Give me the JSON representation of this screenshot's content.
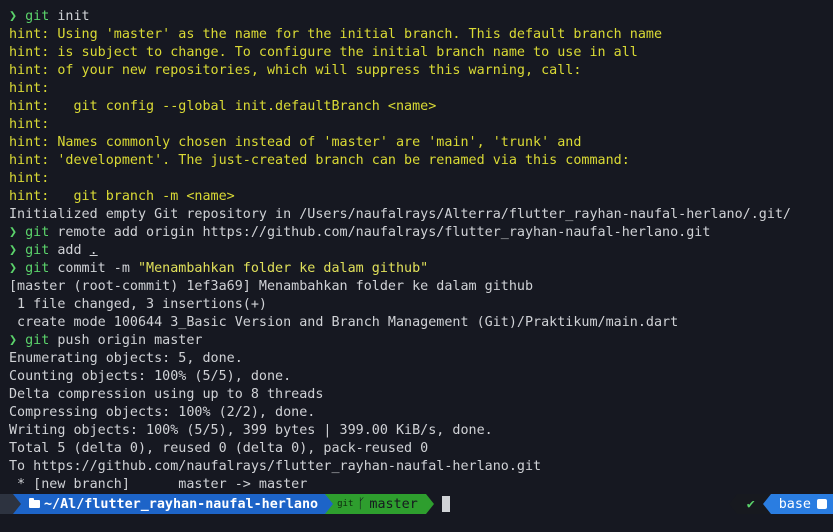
{
  "terminal": {
    "lines": [
      {
        "type": "cmd",
        "prompt": "❯",
        "git": "git",
        "rest": " init"
      },
      {
        "type": "hint",
        "text": "hint: Using 'master' as the name for the initial branch. This default branch name"
      },
      {
        "type": "hint",
        "text": "hint: is subject to change. To configure the initial branch name to use in all"
      },
      {
        "type": "hint",
        "text": "hint: of your new repositories, which will suppress this warning, call:"
      },
      {
        "type": "hint",
        "text": "hint:"
      },
      {
        "type": "hint",
        "text": "hint:   git config --global init.defaultBranch <name>"
      },
      {
        "type": "hint",
        "text": "hint:"
      },
      {
        "type": "hint",
        "text": "hint: Names commonly chosen instead of 'master' are 'main', 'trunk' and"
      },
      {
        "type": "hint",
        "text": "hint: 'development'. The just-created branch can be renamed via this command:"
      },
      {
        "type": "hint",
        "text": "hint:"
      },
      {
        "type": "hint",
        "text": "hint:   git branch -m <name>"
      },
      {
        "type": "out",
        "text": "Initialized empty Git repository in /Users/naufalrays/Alterra/flutter_rayhan-naufal-herlano/.git/"
      },
      {
        "type": "cmd",
        "prompt": "❯",
        "git": "git",
        "rest": " remote add origin https://github.com/naufalrays/flutter_rayhan-naufal-herlano.git"
      },
      {
        "type": "cmd_add",
        "prompt": "❯",
        "git": "git",
        "rest": " add ",
        "arg": "."
      },
      {
        "type": "cmd_commit",
        "prompt": "❯",
        "git": "git",
        "rest": " commit -m ",
        "str": "\"Menambahkan folder ke dalam github\""
      },
      {
        "type": "out",
        "text": "[master (root-commit) 1ef3a69] Menambahkan folder ke dalam github"
      },
      {
        "type": "out",
        "text": " 1 file changed, 3 insertions(+)"
      },
      {
        "type": "out",
        "text": " create mode 100644 3_Basic Version and Branch Management (Git)/Praktikum/main.dart"
      },
      {
        "type": "cmd",
        "prompt": "❯",
        "git": "git",
        "rest": " push origin master"
      },
      {
        "type": "out",
        "text": "Enumerating objects: 5, done."
      },
      {
        "type": "out",
        "text": "Counting objects: 100% (5/5), done."
      },
      {
        "type": "out",
        "text": "Delta compression using up to 8 threads"
      },
      {
        "type": "out",
        "text": "Compressing objects: 100% (2/2), done."
      },
      {
        "type": "out",
        "text": "Writing objects: 100% (5/5), 399 bytes | 399.00 KiB/s, done."
      },
      {
        "type": "out",
        "text": "Total 5 (delta 0), reused 0 (delta 0), pack-reused 0"
      },
      {
        "type": "out",
        "text": "To https://github.com/naufalrays/flutter_rayhan-naufal-herlano.git"
      },
      {
        "type": "out",
        "text": " * [new branch]      master -> master"
      }
    ]
  },
  "status_bar": {
    "apple_icon": "apple-logo-icon",
    "folder_icon": "folder-icon",
    "directory": "~/Al/flutter_rayhan-naufal-herlano",
    "git_label": "git",
    "branch_icon": "git-branch-icon",
    "branch": "master",
    "ok_mark": "✔",
    "env_label": "base",
    "env_icon": "python-icon",
    "colors": {
      "background": "#161821",
      "hint": "#dada35",
      "prompt": "#5bd36b",
      "dir_segment": "#1d64c8",
      "git_segment": "#2e9e2e",
      "env_segment": "#2a7de1"
    }
  }
}
